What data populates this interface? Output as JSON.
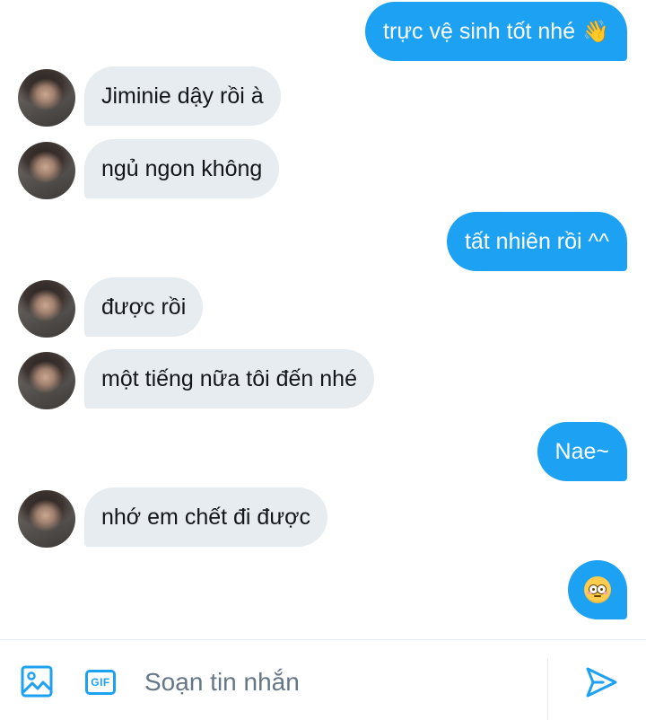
{
  "messages": [
    {
      "direction": "out",
      "text": "trực vệ sinh tốt nhé",
      "emoji": "👋"
    },
    {
      "direction": "in",
      "text": "Jiminie dậy rồi à"
    },
    {
      "direction": "in",
      "text": "ngủ ngon không"
    },
    {
      "direction": "out",
      "text": "tất nhiên rồi ^^"
    },
    {
      "direction": "in",
      "text": "được rồi"
    },
    {
      "direction": "in",
      "text": "một tiếng nữa tôi đến nhé"
    },
    {
      "direction": "out",
      "text": "Nae~"
    },
    {
      "direction": "in",
      "text": "nhớ em chết đi được"
    },
    {
      "direction": "out",
      "text": "",
      "emoji_icon": "flushed-face"
    }
  ],
  "composer": {
    "placeholder": "Soạn tin nhắn",
    "gif_label": "GIF",
    "image_icon": "image-icon",
    "send_icon": "send-icon"
  },
  "colors": {
    "accent": "#1da1f2",
    "incoming_bubble": "#e6ecf0",
    "text": "#14171a",
    "placeholder": "#657786"
  }
}
